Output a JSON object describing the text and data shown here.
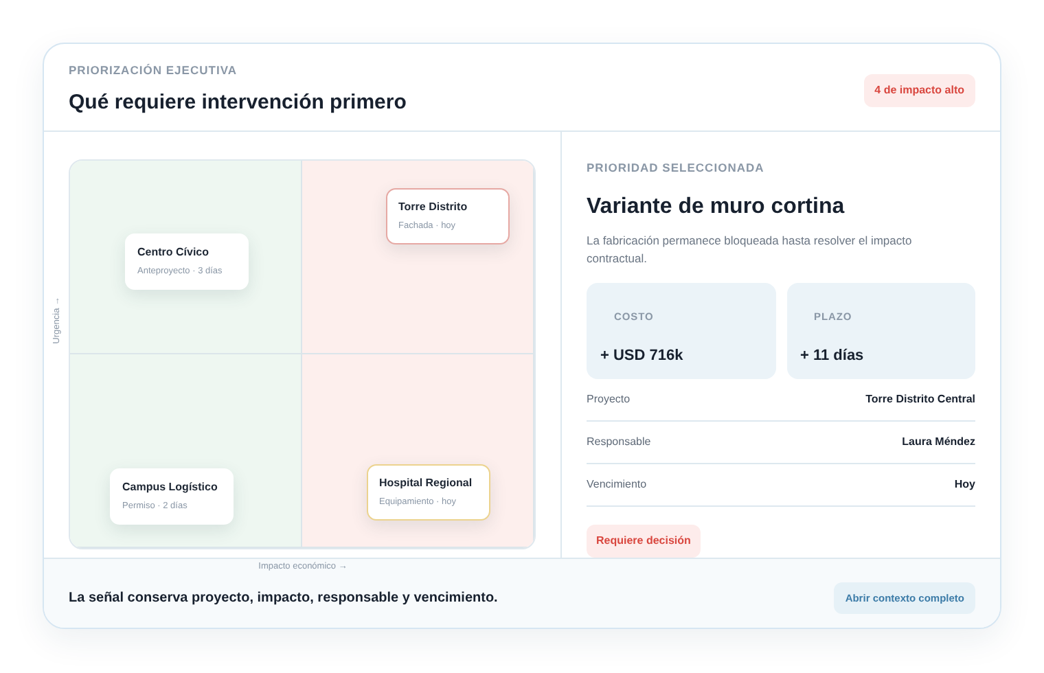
{
  "header": {
    "eyebrow": "PRIORIZACIÓN EJECUTIVA",
    "title": "Qué requiere intervención primero",
    "badge": "4 de impacto alto"
  },
  "matrix": {
    "y_axis": "Urgencia →",
    "x_axis": "Impacto económico →",
    "items": [
      {
        "name": "Torre Distrito",
        "meta": "Fachada · hoy",
        "kind": "critical"
      },
      {
        "name": "Centro Cívico",
        "meta": "Anteproyecto · 3 días",
        "kind": "normal"
      },
      {
        "name": "Campus Logístico",
        "meta": "Permiso · 2 días",
        "kind": "normal"
      },
      {
        "name": "Hospital Regional",
        "meta": "Equipamiento · hoy",
        "kind": "warning"
      }
    ]
  },
  "detail": {
    "eyebrow": "PRIORIDAD SELECCIONADA",
    "title": "Variante de muro cortina",
    "description": "La fabricación permanece bloqueada hasta resolver el impacto contractual.",
    "metrics": [
      {
        "label": "COSTO",
        "value": "+ USD 716k"
      },
      {
        "label": "PLAZO",
        "value": "+ 11 días"
      }
    ],
    "fields": [
      {
        "label": "Proyecto",
        "value": "Torre Distrito Central"
      },
      {
        "label": "Responsable",
        "value": "Laura Méndez"
      },
      {
        "label": "Vencimiento",
        "value": "Hoy"
      }
    ],
    "status": "Requiere decisión"
  },
  "footer": {
    "text": "La señal conserva proyecto, impacto, responsable y vencimiento.",
    "button": "Abrir contexto completo"
  }
}
